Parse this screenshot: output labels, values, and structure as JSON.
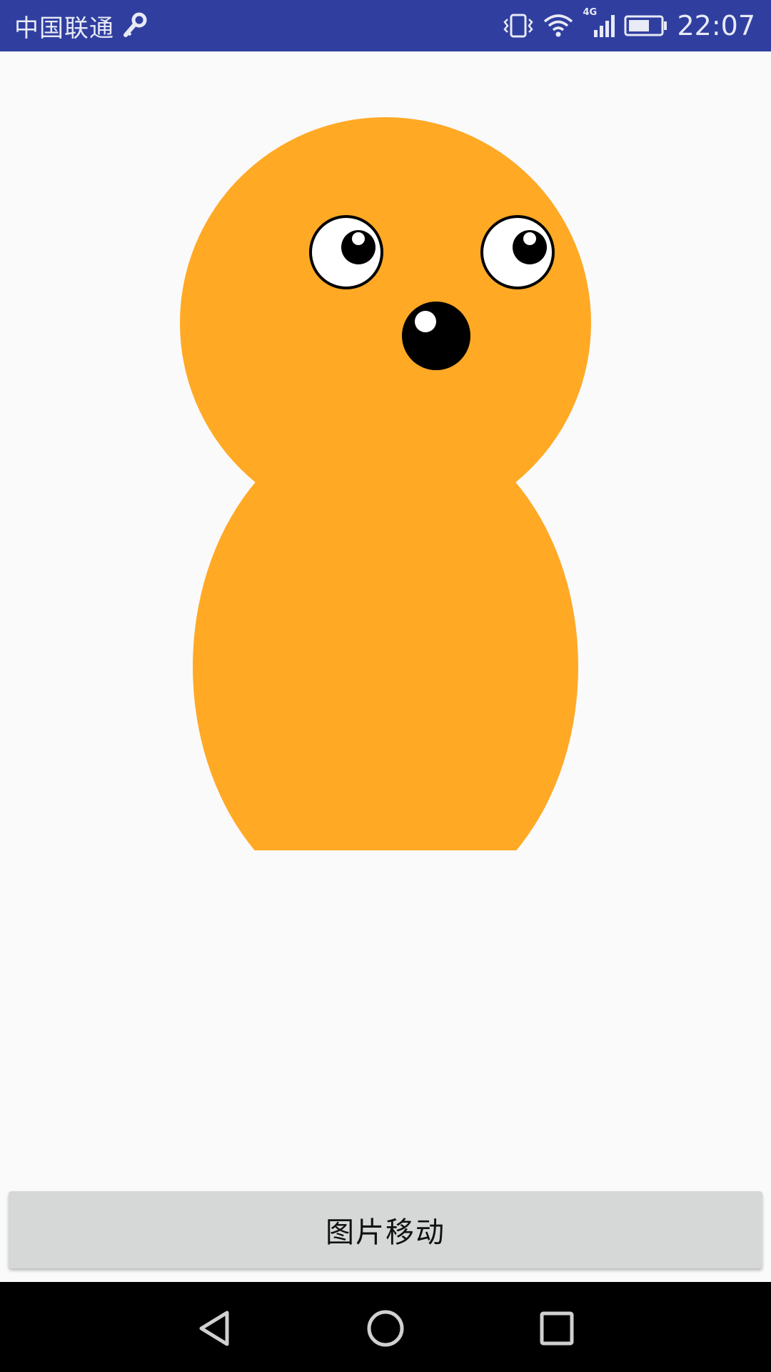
{
  "status_bar": {
    "carrier": "中国联通",
    "network": "4G",
    "time": "22:07",
    "background": "#303f9f"
  },
  "character": {
    "color": "#ffa925",
    "icons": [
      "head",
      "body",
      "left-eye",
      "right-eye",
      "nose"
    ]
  },
  "button": {
    "label": "图片移动"
  },
  "nav_bar": {
    "icons": [
      "back-icon",
      "home-icon",
      "recents-icon"
    ]
  }
}
